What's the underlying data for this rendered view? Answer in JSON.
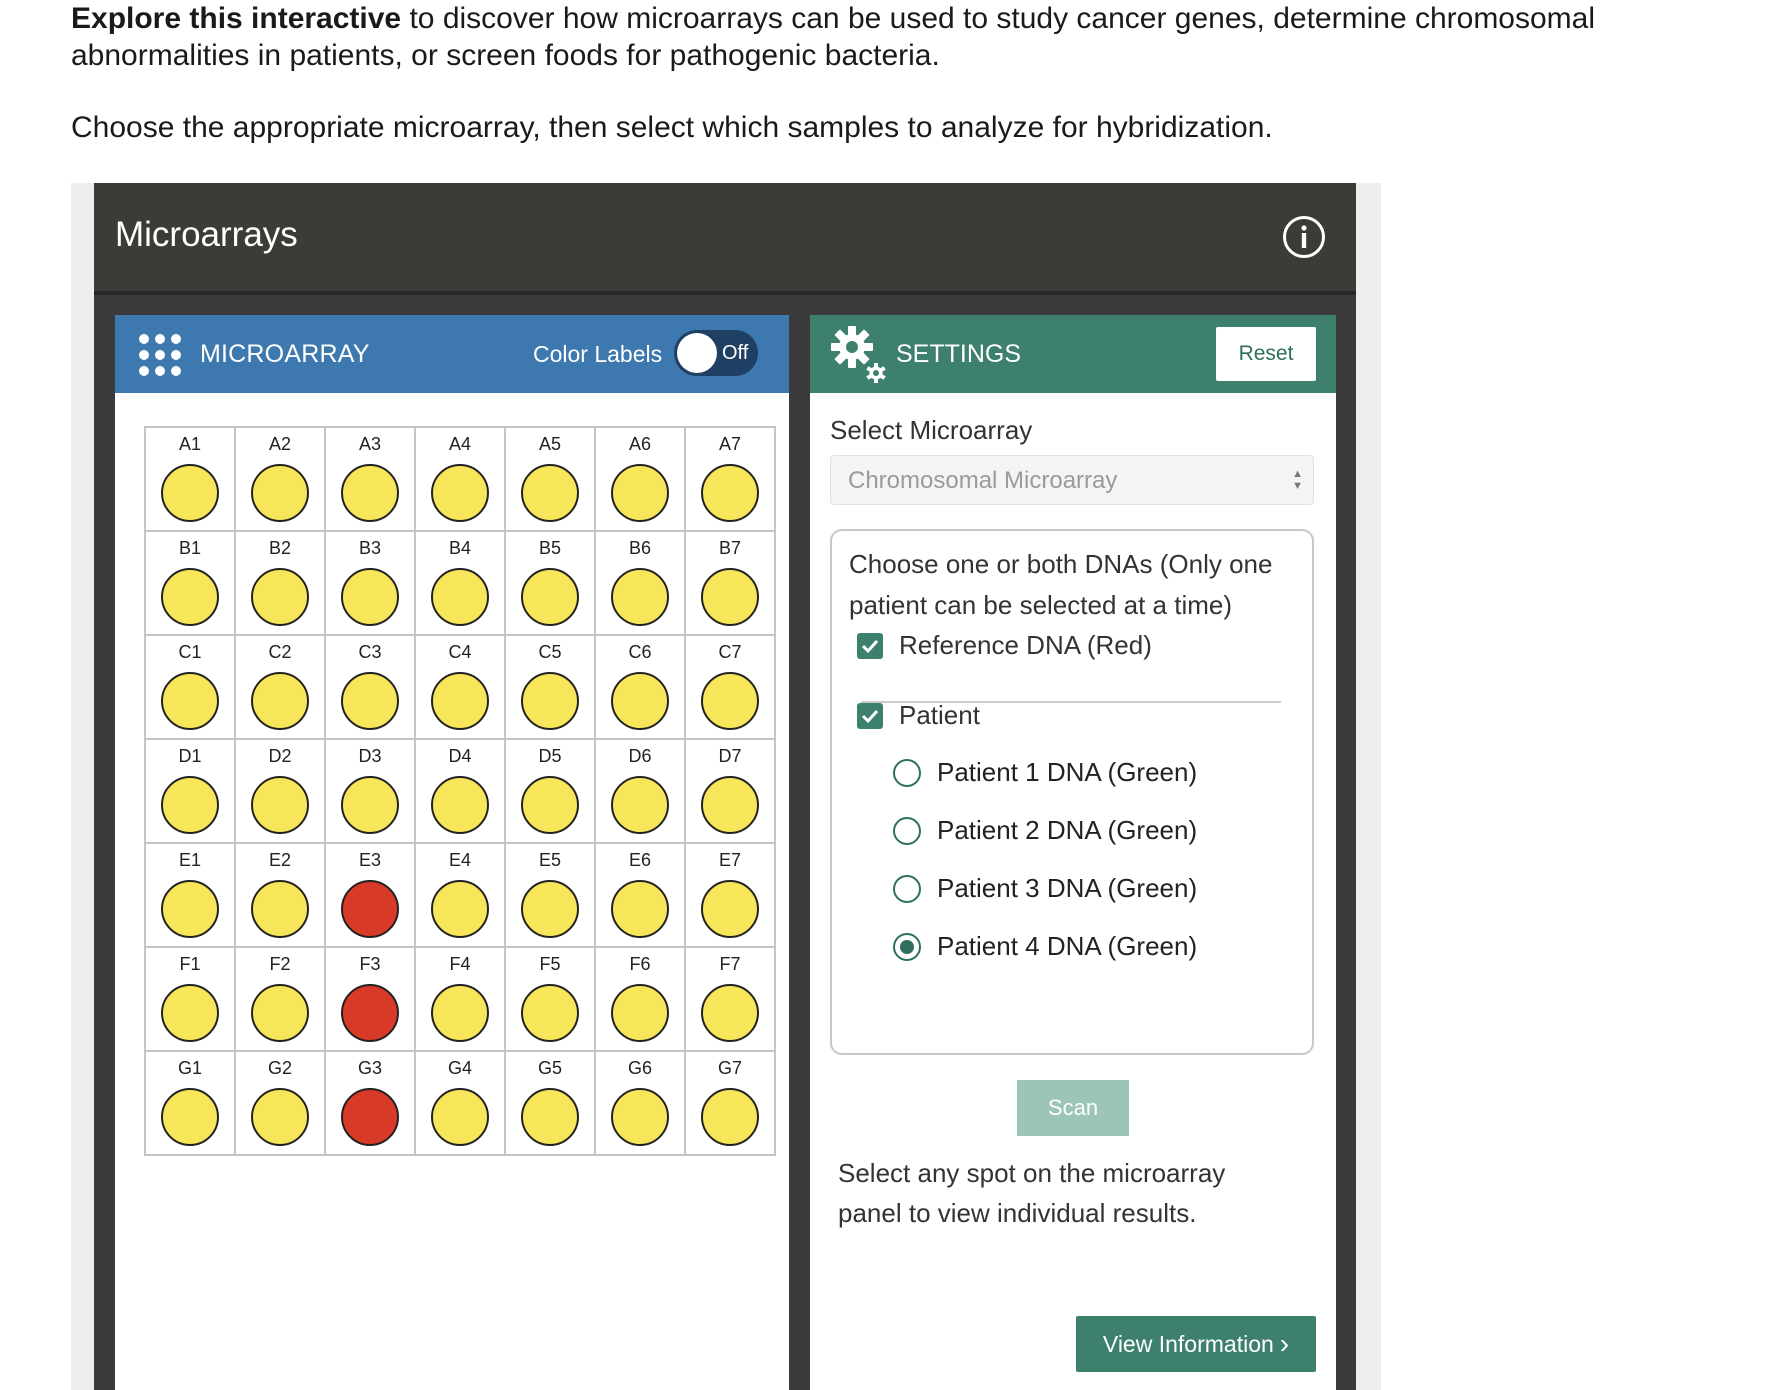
{
  "intro": {
    "bold": "Explore this interactive",
    "rest": " to discover how microarrays can be used to study cancer genes, determine chromosomal abnormalities in patients, or screen foods for pathogenic bacteria.",
    "p2": "Choose the appropriate microarray, then select which samples to analyze for hybridization."
  },
  "app": {
    "title": "Microarrays",
    "info_icon": "info-icon"
  },
  "microarray": {
    "title": "MICROARRAY",
    "color_labels": "Color Labels",
    "toggle_state": "Off",
    "colors": {
      "yellow": "#f7e65a",
      "red": "#d93a27"
    },
    "rows": [
      {
        "row": "A",
        "cells": [
          {
            "label": "A1",
            "color": "yellow"
          },
          {
            "label": "A2",
            "color": "yellow"
          },
          {
            "label": "A3",
            "color": "yellow"
          },
          {
            "label": "A4",
            "color": "yellow"
          },
          {
            "label": "A5",
            "color": "yellow"
          },
          {
            "label": "A6",
            "color": "yellow"
          },
          {
            "label": "A7",
            "color": "yellow"
          }
        ]
      },
      {
        "row": "B",
        "cells": [
          {
            "label": "B1",
            "color": "yellow"
          },
          {
            "label": "B2",
            "color": "yellow"
          },
          {
            "label": "B3",
            "color": "yellow"
          },
          {
            "label": "B4",
            "color": "yellow"
          },
          {
            "label": "B5",
            "color": "yellow"
          },
          {
            "label": "B6",
            "color": "yellow"
          },
          {
            "label": "B7",
            "color": "yellow"
          }
        ]
      },
      {
        "row": "C",
        "cells": [
          {
            "label": "C1",
            "color": "yellow"
          },
          {
            "label": "C2",
            "color": "yellow"
          },
          {
            "label": "C3",
            "color": "yellow"
          },
          {
            "label": "C4",
            "color": "yellow"
          },
          {
            "label": "C5",
            "color": "yellow"
          },
          {
            "label": "C6",
            "color": "yellow"
          },
          {
            "label": "C7",
            "color": "yellow"
          }
        ]
      },
      {
        "row": "D",
        "cells": [
          {
            "label": "D1",
            "color": "yellow"
          },
          {
            "label": "D2",
            "color": "yellow"
          },
          {
            "label": "D3",
            "color": "yellow"
          },
          {
            "label": "D4",
            "color": "yellow"
          },
          {
            "label": "D5",
            "color": "yellow"
          },
          {
            "label": "D6",
            "color": "yellow"
          },
          {
            "label": "D7",
            "color": "yellow"
          }
        ]
      },
      {
        "row": "E",
        "cells": [
          {
            "label": "E1",
            "color": "yellow"
          },
          {
            "label": "E2",
            "color": "yellow"
          },
          {
            "label": "E3",
            "color": "red"
          },
          {
            "label": "E4",
            "color": "yellow"
          },
          {
            "label": "E5",
            "color": "yellow"
          },
          {
            "label": "E6",
            "color": "yellow"
          },
          {
            "label": "E7",
            "color": "yellow"
          }
        ]
      },
      {
        "row": "F",
        "cells": [
          {
            "label": "F1",
            "color": "yellow"
          },
          {
            "label": "F2",
            "color": "yellow"
          },
          {
            "label": "F3",
            "color": "red"
          },
          {
            "label": "F4",
            "color": "yellow"
          },
          {
            "label": "F5",
            "color": "yellow"
          },
          {
            "label": "F6",
            "color": "yellow"
          },
          {
            "label": "F7",
            "color": "yellow"
          }
        ]
      },
      {
        "row": "G",
        "cells": [
          {
            "label": "G1",
            "color": "yellow"
          },
          {
            "label": "G2",
            "color": "yellow"
          },
          {
            "label": "G3",
            "color": "red"
          },
          {
            "label": "G4",
            "color": "yellow"
          },
          {
            "label": "G5",
            "color": "yellow"
          },
          {
            "label": "G6",
            "color": "yellow"
          },
          {
            "label": "G7",
            "color": "yellow"
          }
        ]
      }
    ]
  },
  "settings": {
    "title": "SETTINGS",
    "reset_label": "Reset",
    "select_label": "Select Microarray",
    "select_value": "Chromosomal Microarray",
    "choose_text": "Choose one or both DNAs (Only one patient can be selected at a time)",
    "reference": {
      "label": "Reference DNA (Red)",
      "checked": true
    },
    "patient": {
      "label": "Patient",
      "checked": true
    },
    "patients": [
      {
        "label": "Patient 1 DNA (Green)",
        "selected": false
      },
      {
        "label": "Patient 2 DNA (Green)",
        "selected": false
      },
      {
        "label": "Patient 3 DNA (Green)",
        "selected": false
      },
      {
        "label": "Patient 4 DNA (Green)",
        "selected": true
      }
    ],
    "scan_label": "Scan",
    "hint": "Select any spot on the microarray panel to view individual results.",
    "view_info_label": "View Information"
  }
}
